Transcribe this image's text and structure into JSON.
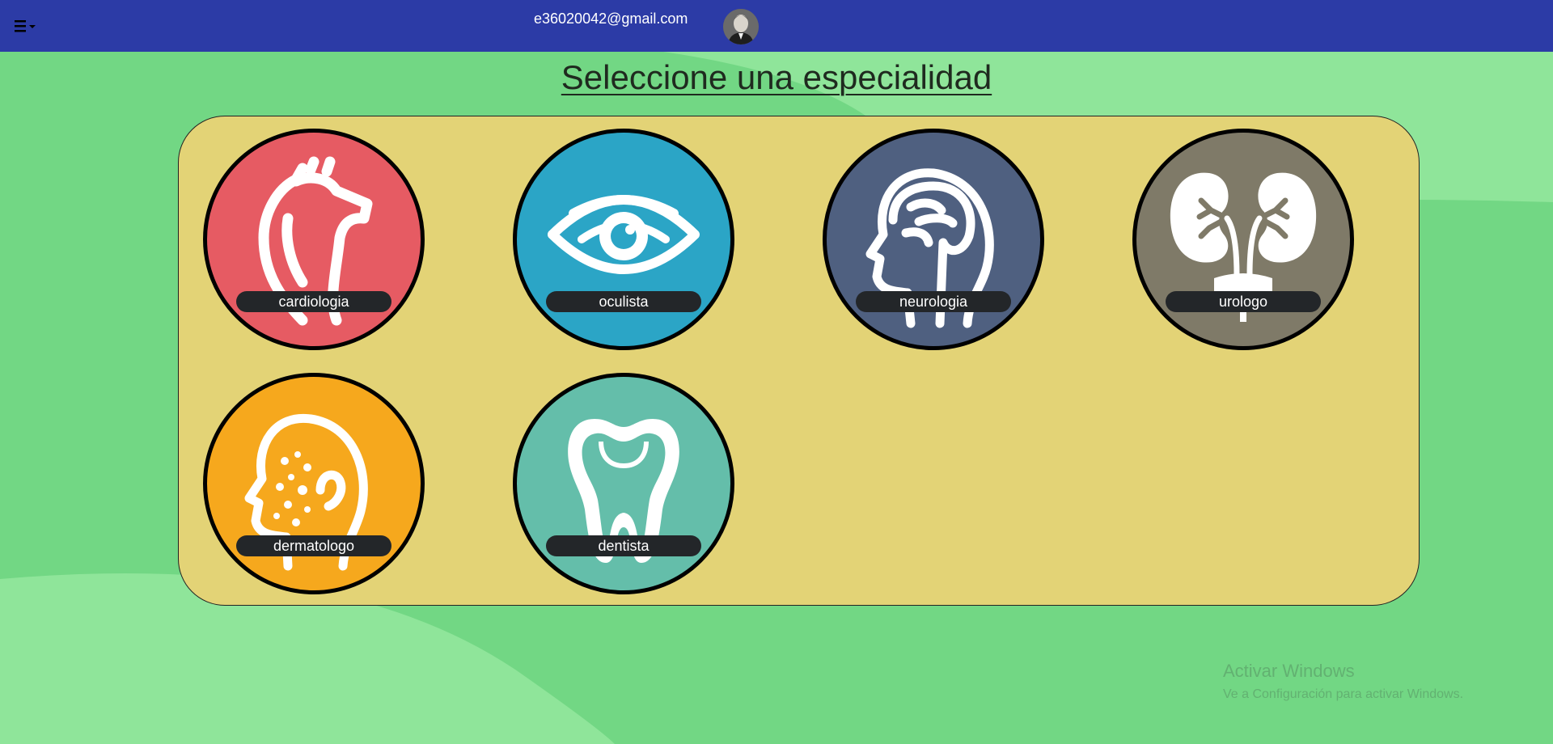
{
  "navbar": {
    "user_email": "e36020042@gmail.com",
    "menu_icon": "hamburger-menu-icon",
    "avatar_icon": "user-avatar"
  },
  "page": {
    "title": "Seleccione una especialidad"
  },
  "specialties": [
    {
      "label": "cardiologia",
      "icon": "heart-icon",
      "color": "#e65b63"
    },
    {
      "label": "oculista",
      "icon": "eye-icon",
      "color": "#2ba5c6"
    },
    {
      "label": "neurologia",
      "icon": "brain-icon",
      "color": "#4f6080"
    },
    {
      "label": "urologo",
      "icon": "kidneys-icon",
      "color": "#7f7a68"
    },
    {
      "label": "dermatologo",
      "icon": "skin-head-icon",
      "color": "#f6a81d"
    },
    {
      "label": "dentista",
      "icon": "tooth-icon",
      "color": "#64beaa"
    }
  ],
  "watermark": {
    "line1": "Activar Windows",
    "line2": "Ve a Configuración para activar Windows."
  },
  "colors": {
    "navbar": "#2c3ba6",
    "background": "#72d784",
    "panel": "#e3d376"
  }
}
